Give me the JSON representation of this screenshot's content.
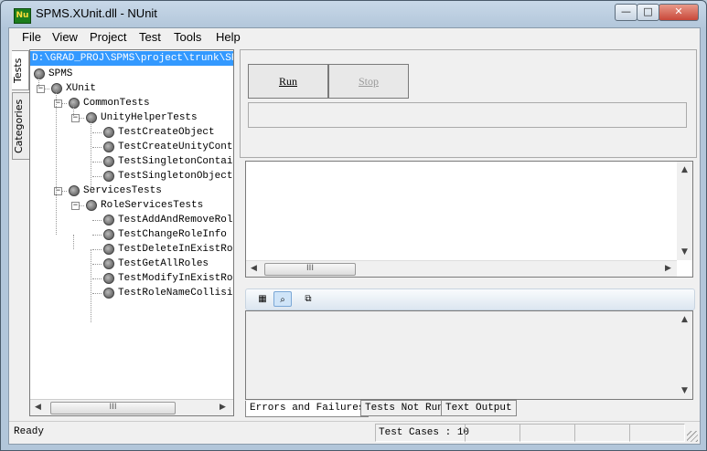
{
  "window": {
    "title": "SPMS.XUnit.dll - NUnit",
    "icon_text": "Nu"
  },
  "menu": [
    "File",
    "View",
    "Project",
    "Test",
    "Tools",
    "Help"
  ],
  "side_tabs": [
    "Tests",
    "Categories"
  ],
  "tree": {
    "path": "D:\\GRAD_PROJ\\SPMS\\project\\trunk\\SPMS",
    "nodes": [
      {
        "label": "SPMS",
        "depth": 0,
        "expander": ""
      },
      {
        "label": "XUnit",
        "depth": 1,
        "expander": "-"
      },
      {
        "label": "CommonTests",
        "depth": 2,
        "expander": "-"
      },
      {
        "label": "UnityHelperTests",
        "depth": 3,
        "expander": "-"
      },
      {
        "label": "TestCreateObject",
        "depth": 4,
        "expander": ""
      },
      {
        "label": "TestCreateUnityContainer",
        "depth": 4,
        "expander": ""
      },
      {
        "label": "TestSingletonContainer",
        "depth": 4,
        "expander": ""
      },
      {
        "label": "TestSingletonObject",
        "depth": 4,
        "expander": ""
      },
      {
        "label": "ServicesTests",
        "depth": 2,
        "expander": "-"
      },
      {
        "label": "RoleServicesTests",
        "depth": 3,
        "expander": "-"
      },
      {
        "label": "TestAddAndRemoveRole",
        "depth": 4,
        "expander": ""
      },
      {
        "label": "TestChangeRoleInfo",
        "depth": 4,
        "expander": ""
      },
      {
        "label": "TestDeleteInExistRole",
        "depth": 4,
        "expander": ""
      },
      {
        "label": "TestGetAllRoles",
        "depth": 4,
        "expander": ""
      },
      {
        "label": "TestModifyInExistRole",
        "depth": 4,
        "expander": ""
      },
      {
        "label": "TestRoleNameCollision",
        "depth": 4,
        "expander": ""
      }
    ]
  },
  "run_panel": {
    "run_label": "Run",
    "stop_label": "Stop"
  },
  "scroll_thumb": "III",
  "bottom_tabs": [
    "Errors and Failures",
    "Tests Not Run",
    "Text Output"
  ],
  "status": {
    "ready": "Ready",
    "test_cases": "Test Cases : 10"
  }
}
